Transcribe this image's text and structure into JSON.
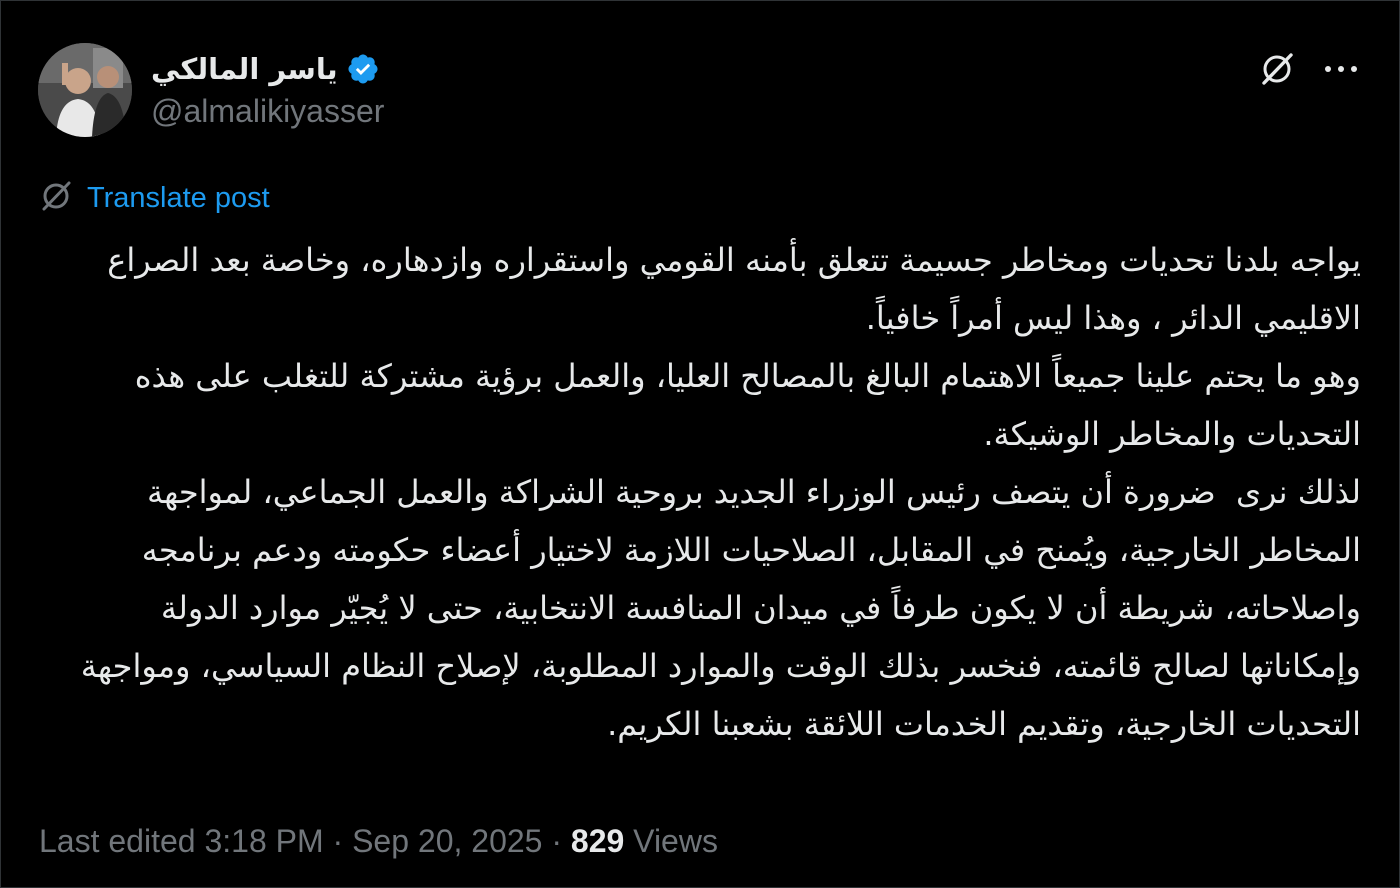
{
  "author": {
    "display_name": "ياسر المالكي",
    "handle": "@almalikiyasser",
    "verified": true,
    "avatar": "avatar-photo"
  },
  "actions": {
    "grok_icon": "grok-icon",
    "more_icon": "more-icon"
  },
  "translate": {
    "label": "Translate post",
    "icon": "translate-icon"
  },
  "post": {
    "paragraphs": [
      "يواجه بلدنا تحديات ومخاطر جسيمة تتعلق بأمنه القومي واستقراره وازدهاره، وخاصة بعد الصراع الاقليمي الدائر ، وهذا ليس أمراً خافياً.",
      "وهو ما يحتم علينا جميعاً الاهتمام البالغ بالمصالح العليا، والعمل برؤية مشتركة للتغلب على هذه التحديات والمخاطر الوشيكة.",
      "لذلك نرى  ضرورة أن يتصف رئيس الوزراء الجديد بروحية الشراكة والعمل الجماعي، لمواجهة المخاطر الخارجية، ويُمنح في المقابل، الصلاحيات اللازمة لاختيار أعضاء حكومته ودعم برنامجه واصلاحاته، شريطة أن لا يكون طرفاً في ميدان المنافسة الانتخابية، حتى لا يُجيّر موارد الدولة وإمكاناتها لصالح قائمته، فنخسر بذلك الوقت والموارد المطلوبة، لإصلاح النظام السياسي، ومواجهة التحديات الخارجية، وتقديم الخدمات اللائقة بشعبنا الكريم."
    ]
  },
  "meta": {
    "edited": "Last edited 3:18 PM",
    "separator": " · ",
    "date": "Sep 20, 2025",
    "views_count": "829",
    "views_label": " Views"
  },
  "colors": {
    "background": "#000000",
    "text": "#e7e9ea",
    "muted": "#71767b",
    "link": "#1d9bf0",
    "verified": "#1d9bf0"
  }
}
